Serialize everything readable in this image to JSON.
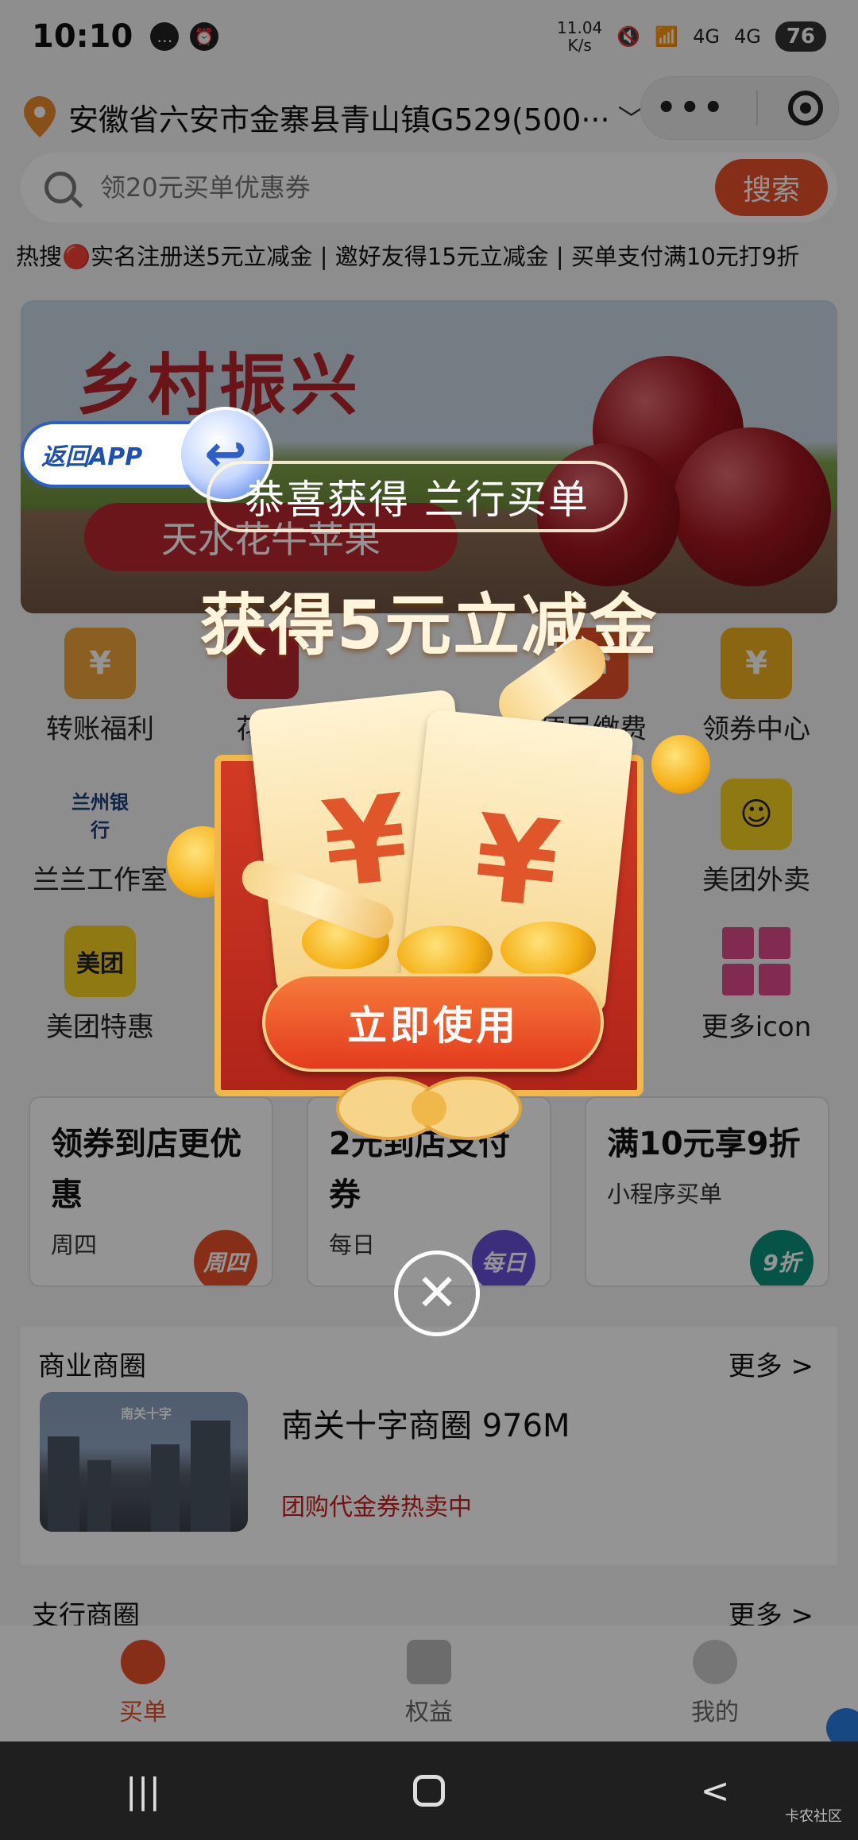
{
  "status_bar": {
    "time": "10:10",
    "net_speed_value": "11.04",
    "net_speed_unit": "K/s",
    "signal_1": "4G",
    "signal_2": "4G",
    "battery": "76"
  },
  "location": {
    "address": "安徽省六安市金寨县青山镇G529(500···",
    "more_icon": "more-dots-icon",
    "close_icon": "target-circle-icon"
  },
  "search": {
    "placeholder": "领20元买单优惠券",
    "button": "搜索"
  },
  "ticker": {
    "text": "热搜🔴实名注册送5元立减金 | 邀好友得15元立减金 | 买单支付满10元打9折"
  },
  "banner": {
    "title": "乡村振兴",
    "subtitle": "天水花牛苹果"
  },
  "grid": [
    {
      "label": "转账福利",
      "icon": "money-bag-icon"
    },
    {
      "label": "花牛",
      "icon": "apple-icon"
    },
    {
      "label": "便民缴费",
      "icon": "phone-icon"
    },
    {
      "label": "领券中心",
      "icon": "coupon-icon"
    },
    {
      "label": "兰兰工作室",
      "icon": "bank-logo-icon",
      "logo_text": "兰州银行"
    },
    {
      "label": "美团外卖",
      "icon": "meituan-mascot-icon"
    },
    {
      "label": "美团特惠",
      "icon": "meituan-icon",
      "logo_text": "美团"
    },
    {
      "label": "更多icon",
      "icon": "grid-more-icon"
    }
  ],
  "cards": [
    {
      "title": "领券到店更优惠",
      "sub": "周四",
      "badge": "周四",
      "badge_color": "#e8502a"
    },
    {
      "title": "2元到店支付券",
      "sub": "每日",
      "badge": "每日",
      "badge_color": "#6a4fd8"
    },
    {
      "title": "满10元享9折",
      "sub": "小程序买单",
      "badge": "9折",
      "badge_color": "#0c8f7a"
    }
  ],
  "district": {
    "heading": "商业商圈",
    "more": "更多 >",
    "image_sign": "南关十字",
    "name": "南关十字商圈  976M",
    "tag": "团购代金券热卖中"
  },
  "section2": {
    "heading": "支行商圈",
    "more": "更多 >"
  },
  "tabbar": [
    {
      "label": "买单",
      "icon": "bill-icon",
      "active": true
    },
    {
      "label": "权益",
      "icon": "benefit-icon",
      "active": false
    },
    {
      "label": "我的",
      "icon": "profile-icon",
      "active": false
    }
  ],
  "navbar": {
    "recent": "|||",
    "back": "<",
    "watermark": "卡农社区"
  },
  "popup": {
    "back_app": "返回APP",
    "congrats": "恭喜获得 兰行买单",
    "gain": "获得5元立减金",
    "ticket_symbol": "¥",
    "use_button": "立即使用",
    "close": "✕"
  },
  "colors": {
    "accent": "#e8502a",
    "overlay": "rgba(0,0,0,0.42)",
    "popup_red": "#c82a1e",
    "gold": "#f5b016"
  }
}
